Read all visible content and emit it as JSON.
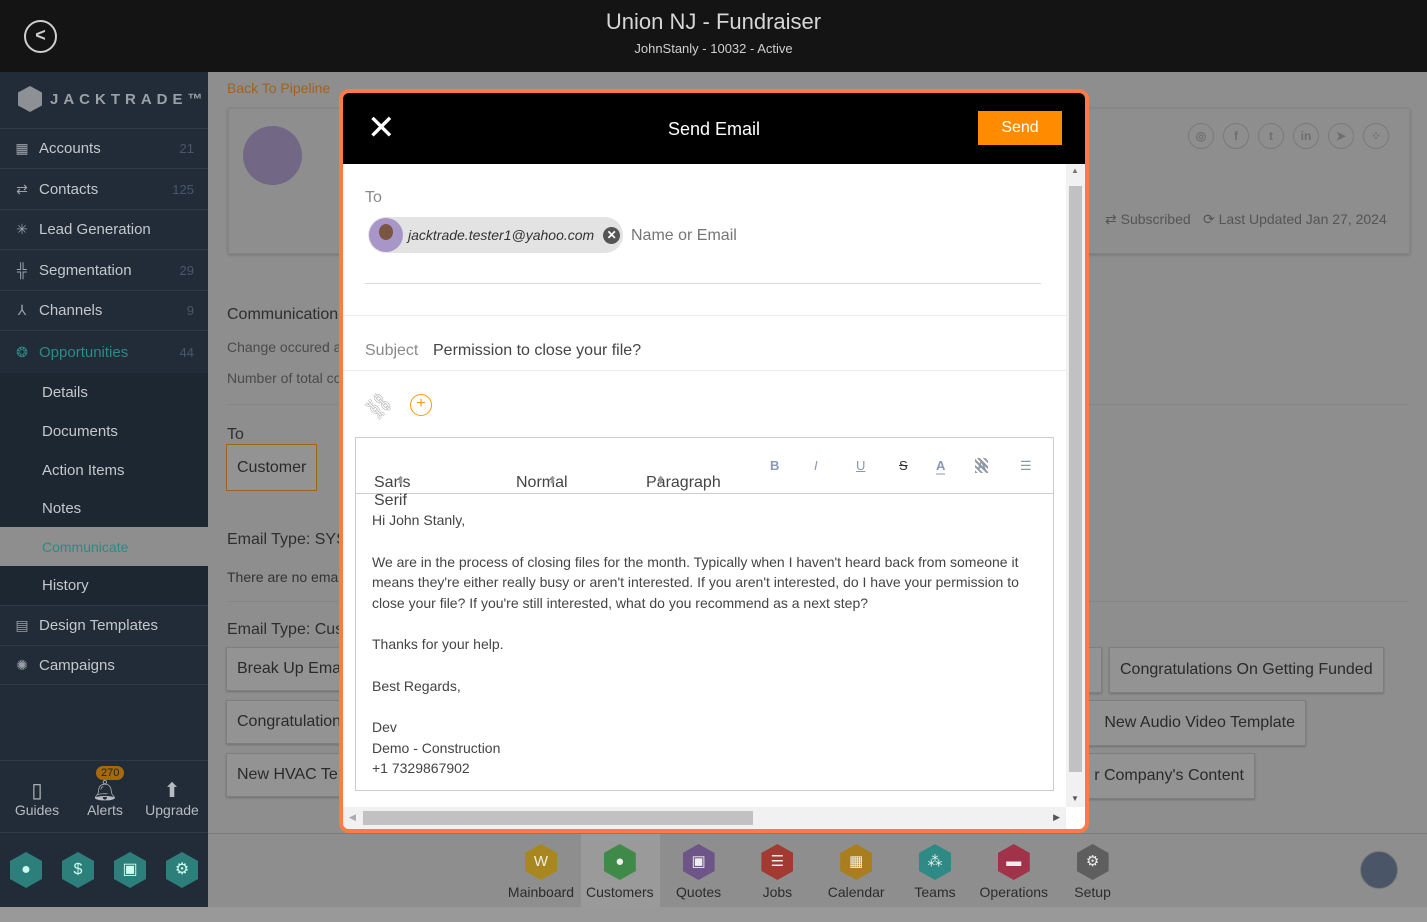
{
  "header": {
    "title": "Union NJ - Fundraiser",
    "subtitle": "JohnStanly - 10032 - Active"
  },
  "sidebar": {
    "logo": "JACKTRADE™",
    "items": [
      {
        "label": "Accounts",
        "count": "21",
        "icon": "building-icon"
      },
      {
        "label": "Contacts",
        "count": "125",
        "icon": "contacts-icon"
      },
      {
        "label": "Lead Generation",
        "count": "",
        "icon": "lead-icon"
      },
      {
        "label": "Segmentation",
        "count": "29",
        "icon": "segmentation-icon"
      },
      {
        "label": "Channels",
        "count": "9",
        "icon": "channels-icon"
      },
      {
        "label": "Opportunities",
        "count": "44",
        "icon": "opportunities-icon"
      }
    ],
    "subitems": [
      "Details",
      "Documents",
      "Action Items",
      "Notes",
      "Communicate",
      "History"
    ],
    "items2": [
      {
        "label": "Design Templates",
        "icon": "templates-icon"
      },
      {
        "label": "Campaigns",
        "icon": "campaigns-icon"
      }
    ],
    "bottom": {
      "guides": "Guides",
      "alerts": "Alerts",
      "alerts_count": "270",
      "upgrade": "Upgrade"
    }
  },
  "main": {
    "back_link": "Back To Pipeline",
    "status": "Subscribed",
    "last_updated": "Last Updated Jan 27, 2024",
    "communication": "Communication",
    "change_text": "Change occured a",
    "number_text": "Number of total co",
    "to_label": "To",
    "to_value": "Customer",
    "email_type_sys": "Email Type: SYS",
    "no_email": "There are no email",
    "email_type_custom": "Email Type: Cus",
    "templates_left": [
      "Break Up Ema",
      "Congratulation",
      "New HVAC Te"
    ],
    "templates_right": [
      "Congratulations On Getting Funded",
      "New Audio Video Template",
      "r Company's Content"
    ]
  },
  "modal": {
    "title": "Send Email",
    "send": "Send",
    "to_label": "To",
    "recipient": "jacktrade.tester1@yahoo.com",
    "to_placeholder": "Name or Email",
    "subject_label": "Subject",
    "subject": "Permission to close your file?",
    "toolbar": {
      "font": "Sans Serif",
      "size": "Normal",
      "block": "Paragraph",
      "bold": "B",
      "italic": "I",
      "underline": "U",
      "strike": "S",
      "color": "A",
      "highlight": "A",
      "list": "☰"
    },
    "body": {
      "greeting": "Hi John Stanly,",
      "para": "We are in the process of closing files for the month. Typically when I haven't heard back from someone it means they're either really busy or aren't interested. If you aren't interested, do I have your permission to close your file? If you're still interested, what do you recommend as a next step?",
      "thanks": "Thanks for your help.",
      "regards": "Best Regards,",
      "name": "Dev",
      "company": "Demo - Construction",
      "phone": "+1 7329867902"
    }
  },
  "bottom_nav": [
    {
      "label": "Mainboard",
      "color": "#a8871e"
    },
    {
      "label": "Customers",
      "color": "#3f8a48"
    },
    {
      "label": "Quotes",
      "color": "#6d5587"
    },
    {
      "label": "Jobs",
      "color": "#a33a32"
    },
    {
      "label": "Calendar",
      "color": "#a97e1e"
    },
    {
      "label": "Teams",
      "color": "#2e8a84"
    },
    {
      "label": "Operations",
      "color": "#a0334a"
    },
    {
      "label": "Setup",
      "color": "#5e5e5e"
    }
  ],
  "colors": {
    "accent": "#ff8c00",
    "modal_border": "#ff7a45",
    "sidebar": "#212c38",
    "teal": "#2d8a86"
  }
}
